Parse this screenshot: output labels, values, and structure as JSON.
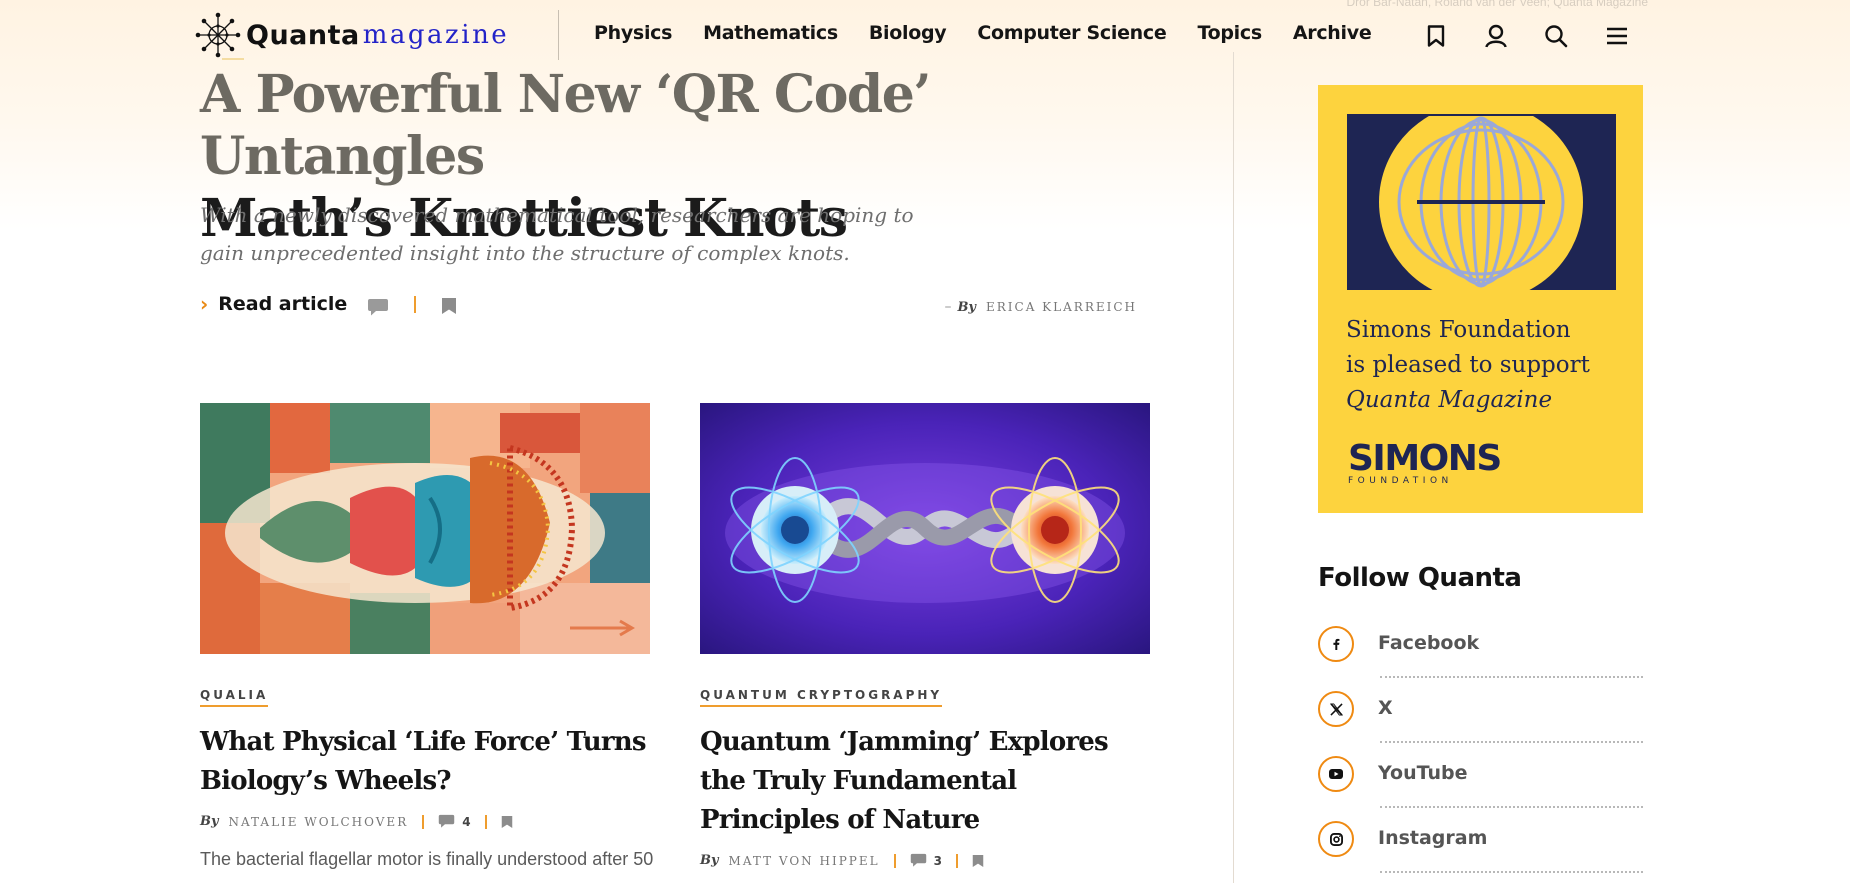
{
  "header": {
    "logo": {
      "word": "Quanta",
      "mag": "magazine"
    },
    "nav": [
      {
        "label": "Physics"
      },
      {
        "label": "Mathematics"
      },
      {
        "label": "Biology"
      },
      {
        "label": "Computer Science"
      },
      {
        "label": "Topics"
      },
      {
        "label": "Archive"
      }
    ],
    "icons": [
      "bookmark-icon",
      "user-icon",
      "search-icon",
      "menu-icon"
    ],
    "faint_credit": "Dror Bar-Natan, Roland van der Veen; Quanta Magazine"
  },
  "hero": {
    "title_line1": "A Powerful New ‘QR Code’ Untangles",
    "title_line2": "Math’s Knottiest Knots",
    "dek": "With a newly discovered mathematical tool, researchers are hoping to gain unprecedented insight into the structure of complex knots.",
    "read_label": "Read article",
    "by": "By",
    "author": "Erica Klarreich"
  },
  "cards": [
    {
      "kicker": "QUALIA",
      "title": "What Physical ‘Life Force’ Turns Biology’s Wheels?",
      "by": "By",
      "author": "Natalie Wolchover",
      "comments": "4",
      "excerpt": "The bacterial flagellar motor is finally understood after 50"
    },
    {
      "kicker": "QUANTUM CRYPTOGRAPHY",
      "title": "Quantum ‘Jamming’ Explores the Truly Fundamental Principles of Nature",
      "by": "By",
      "author": "Matt von Hippel",
      "comments": "3"
    }
  ],
  "sidebar": {
    "ad": {
      "line1": "Simons Foundation",
      "line2": "is pleased to support",
      "line3": "Quanta Magazine",
      "logo_word": "SIMONS",
      "logo_sub": "FOUNDATION"
    },
    "follow_title": "Follow Quanta",
    "social": [
      {
        "label": "Facebook",
        "icon": "facebook-icon"
      },
      {
        "label": "X",
        "icon": "x-icon"
      },
      {
        "label": "YouTube",
        "icon": "youtube-icon"
      },
      {
        "label": "Instagram",
        "icon": "instagram-icon"
      }
    ]
  },
  "colors": {
    "accent_orange": "#ef9d2e",
    "logo_blue": "#2323c8",
    "ad_yellow": "#fdd33e",
    "ad_navy": "#1e2553"
  }
}
